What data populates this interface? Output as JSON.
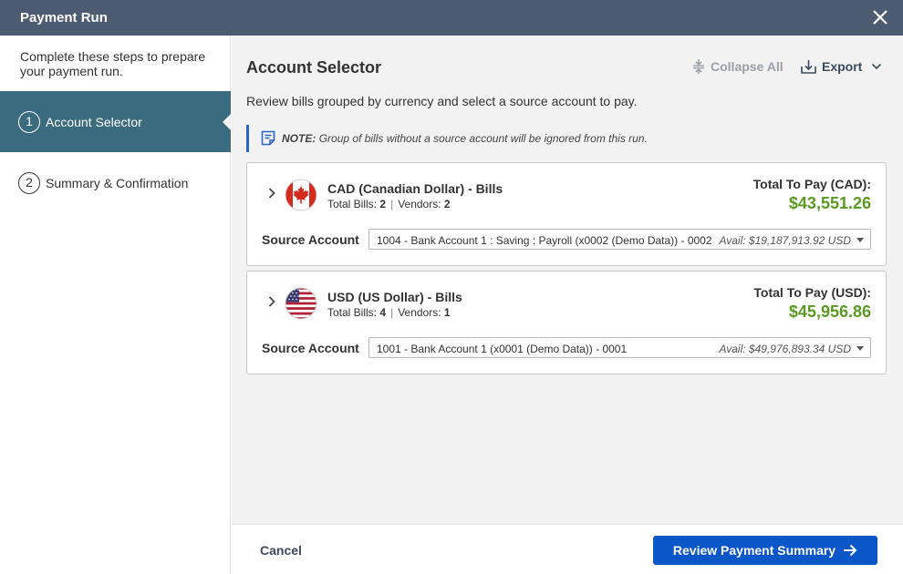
{
  "window": {
    "title": "Payment Run"
  },
  "sidebar": {
    "intro": "Complete these steps to prepare your payment run.",
    "steps": [
      {
        "number": "1",
        "label": "Account Selector",
        "active": true
      },
      {
        "number": "2",
        "label": "Summary & Confirmation",
        "active": false
      }
    ]
  },
  "main": {
    "heading": "Account Selector",
    "toolbar": {
      "collapse_label": "Collapse All",
      "export_label": "Export"
    },
    "description": "Review bills grouped by currency and select a source account to pay.",
    "note": {
      "prefix": "NOTE:",
      "text": "Group of bills without a source account will be ignored from this run."
    },
    "groups": [
      {
        "currency_title": "CAD (Canadian Dollar) - Bills",
        "flag_icon": "canada-flag-icon",
        "total_bills_label": "Total Bills:",
        "total_bills": "2",
        "vendors_label": "Vendors:",
        "vendors": "2",
        "total_label": "Total To Pay (CAD):",
        "total_amount": "$43,551.26",
        "source_label": "Source Account",
        "source_value": "1004 - Bank Account 1 : Saving : Payroll (x0002 (Demo Data)) - 0002",
        "available": "Avail: $19,187,913.92 USD"
      },
      {
        "currency_title": "USD (US Dollar) - Bills",
        "flag_icon": "usa-flag-icon",
        "total_bills_label": "Total Bills:",
        "total_bills": "4",
        "vendors_label": "Vendors:",
        "vendors": "1",
        "total_label": "Total To Pay (USD):",
        "total_amount": "$45,956.86",
        "source_label": "Source Account",
        "source_value": "1001 - Bank Account 1 (x0001 (Demo Data)) - 0001",
        "available": "Avail: $49,976,893.34 USD"
      }
    ]
  },
  "footer": {
    "cancel_label": "Cancel",
    "primary_label": "Review Payment Summary"
  },
  "colors": {
    "titlebar": "#4d5b70",
    "active_step": "#3b6b7f",
    "accent": "#0b57c9",
    "amount": "#5a9a23",
    "note_border": "#2c63c7"
  }
}
